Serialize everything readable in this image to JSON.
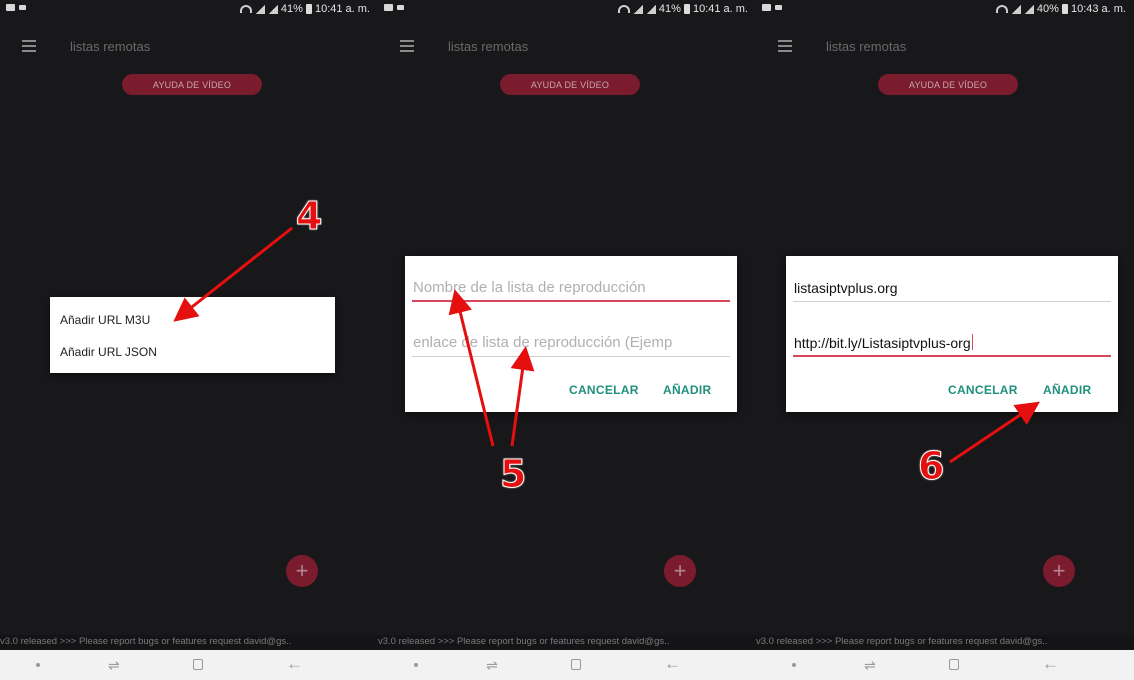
{
  "status_bars": [
    {
      "left_icons": [
        "gallery-icon",
        "video-icon"
      ],
      "battery": "41%",
      "time": "10:41 a. m."
    },
    {
      "left_icons": [
        "gallery-icon",
        "video-icon"
      ],
      "battery": "41%",
      "time": "10:41 a. m."
    },
    {
      "left_icons": [
        "gallery-icon",
        "video-icon"
      ],
      "battery": "40%",
      "time": "10:43 a. m."
    }
  ],
  "app_bar": {
    "title": "listas remotas",
    "menu_icon": "hamburger-icon"
  },
  "video_help_button": "AYUDA DE VÍDEO",
  "add_menu": {
    "items": [
      "Añadir URL M3U",
      "Añadir URL JSON"
    ]
  },
  "dialog_empty": {
    "name_placeholder": "Nombre de la lista de reproducción",
    "link_placeholder": "enlace de lista de reproducción (Ejemp",
    "cancel_label": "CANCELAR",
    "add_label": "AÑADIR"
  },
  "dialog_filled": {
    "name_value": "listasiptvplus.org",
    "link_value": "http://bit.ly/Listasiptvplus-org",
    "cancel_label": "CANCELAR",
    "add_label": "AÑADIR"
  },
  "fab_icon": "plus-icon",
  "fab_label": "+",
  "ticker_text": "v3.0 released >>>  Please report bugs or features request david@gs..",
  "nav_bar": {
    "icons": [
      "dot-icon",
      "recent-apps-icon",
      "home-icon",
      "back-icon"
    ]
  },
  "annotations": {
    "step4": "4",
    "step5": "5",
    "step6": "6",
    "color": "#e60f0f"
  }
}
